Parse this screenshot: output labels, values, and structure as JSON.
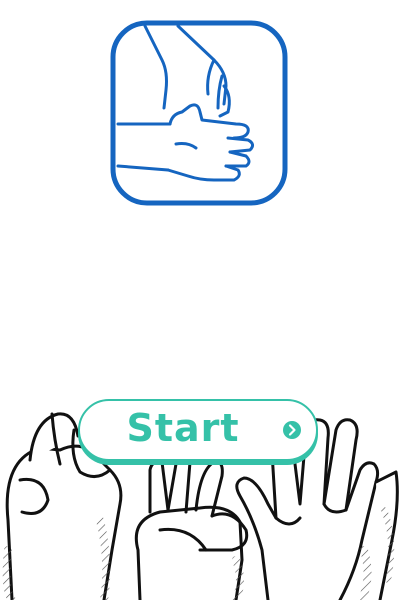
{
  "colors": {
    "logo_blue": "#1565c0",
    "accent_teal": "#35c1a8",
    "background": "#ffffff",
    "sketch_ink": "#111111"
  },
  "logo": {
    "icon": "hands-clasp-icon"
  },
  "start_button": {
    "label": "Start",
    "icon": "chevron-right-circle-icon"
  },
  "illustration": {
    "icon": "rock-paper-scissors-hands-icon"
  }
}
